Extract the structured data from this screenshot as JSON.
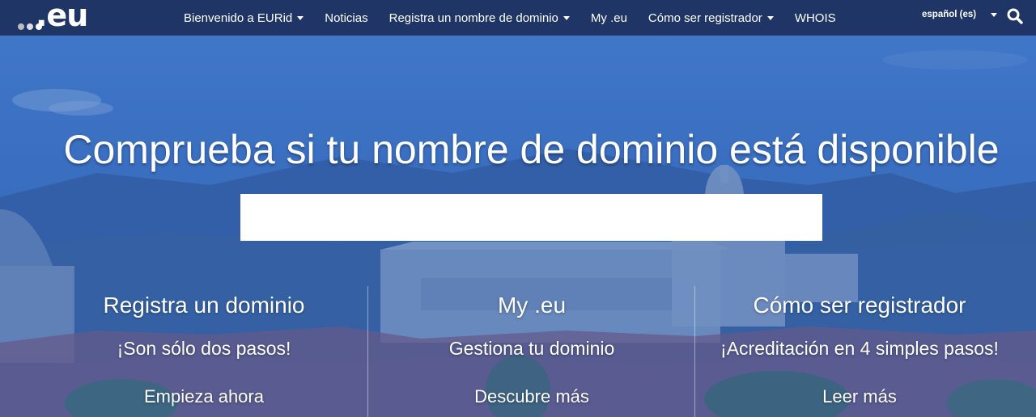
{
  "header": {
    "logo_text": ".eu",
    "logo_dot_colors": [
      "#cfcfcf",
      "#e8e8e8",
      "#ffffff"
    ],
    "nav": [
      {
        "label": "Bienvenido a EURid",
        "dropdown": true
      },
      {
        "label": "Noticias",
        "dropdown": false
      },
      {
        "label": "Registra un nombre de dominio",
        "dropdown": true
      },
      {
        "label": "My .eu",
        "dropdown": false
      },
      {
        "label": "Cómo ser registrador",
        "dropdown": true
      },
      {
        "label": "WHOIS",
        "dropdown": false
      }
    ],
    "language": "español (es)",
    "search_icon": "search-icon"
  },
  "hero": {
    "headline": "Comprueba si tu nombre de dominio está disponible",
    "search_value": "",
    "search_placeholder": ""
  },
  "columns": [
    {
      "title": "Registra un dominio",
      "subtitle": "¡Son sólo dos pasos!",
      "link": "Empieza ahora"
    },
    {
      "title": "My .eu",
      "subtitle": "Gestiona tu dominio",
      "link": "Descubre más"
    },
    {
      "title": "Cómo ser registrador",
      "subtitle": "¡Acreditación en 4 simples pasos!",
      "link": "Leer más"
    }
  ],
  "colors": {
    "nav_bg": "#1f3566",
    "hero_tint": "#3f72be",
    "text": "#ffffff"
  }
}
